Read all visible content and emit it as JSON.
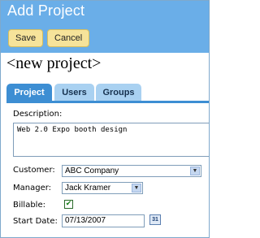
{
  "header": {
    "title": "Add Project",
    "save_label": "Save",
    "cancel_label": "Cancel"
  },
  "project": {
    "name": "<new project>"
  },
  "tabs": [
    {
      "label": "Project",
      "active": true
    },
    {
      "label": "Users",
      "active": false
    },
    {
      "label": "Groups",
      "active": false
    }
  ],
  "form": {
    "description_label": "Description:",
    "description_value": "Web 2.0 Expo booth design",
    "customer_label": "Customer:",
    "customer_value": "ABC Company",
    "manager_label": "Manager:",
    "manager_value": "Jack Kramer",
    "billable_label": "Billable:",
    "billable_checked": true,
    "start_date_label": "Start Date:",
    "start_date_value": "07/13/2007",
    "calendar_icon_text": "31"
  },
  "colors": {
    "header_bg": "#6aaee8",
    "button_bg": "#f6e39a",
    "active_tab": "#3d8ed3",
    "inactive_tab": "#a9d1f1"
  },
  "icons": {
    "dropdown": "chevron-down-icon",
    "calendar": "calendar-icon",
    "check": "checkmark-icon"
  }
}
